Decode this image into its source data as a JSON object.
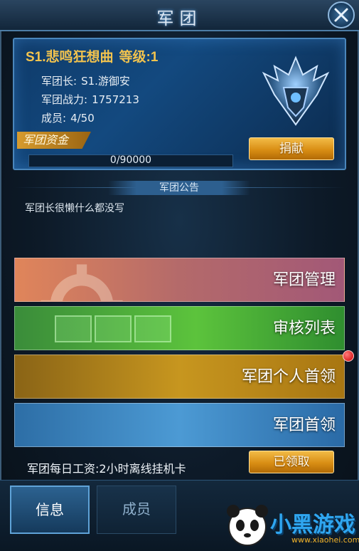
{
  "header": {
    "title": "军团"
  },
  "guild": {
    "name": "S1.悲鸣狂想曲",
    "level_label": "等级:1",
    "leader_label": "军团长:",
    "leader_value": "S1.游御安",
    "power_label": "军团战力:",
    "power_value": "1757213",
    "members_label": "成员:",
    "members_value": "4/50",
    "fund_label": "军团资金",
    "fund_value": "0/90000",
    "fund_progress": 0,
    "donate_label": "捐献"
  },
  "notice": {
    "header": "军团公告",
    "text": "军团长很懒什么都没写"
  },
  "menu": {
    "manage": "军团管理",
    "review": "审核列表",
    "personal_leader": "军团个人首领",
    "guild_leader": "军团首领"
  },
  "salary": {
    "text": "军团每日工资:2小时离线挂机卡",
    "button": "已领取"
  },
  "tabs": {
    "info": "信息",
    "members": "成员"
  },
  "watermark": {
    "text": "小黑游戏",
    "sub": "www.xiaohei.com"
  },
  "colors": {
    "gold": "#f2c34e",
    "accent": "#4a86bb",
    "badge": "#d20000"
  }
}
